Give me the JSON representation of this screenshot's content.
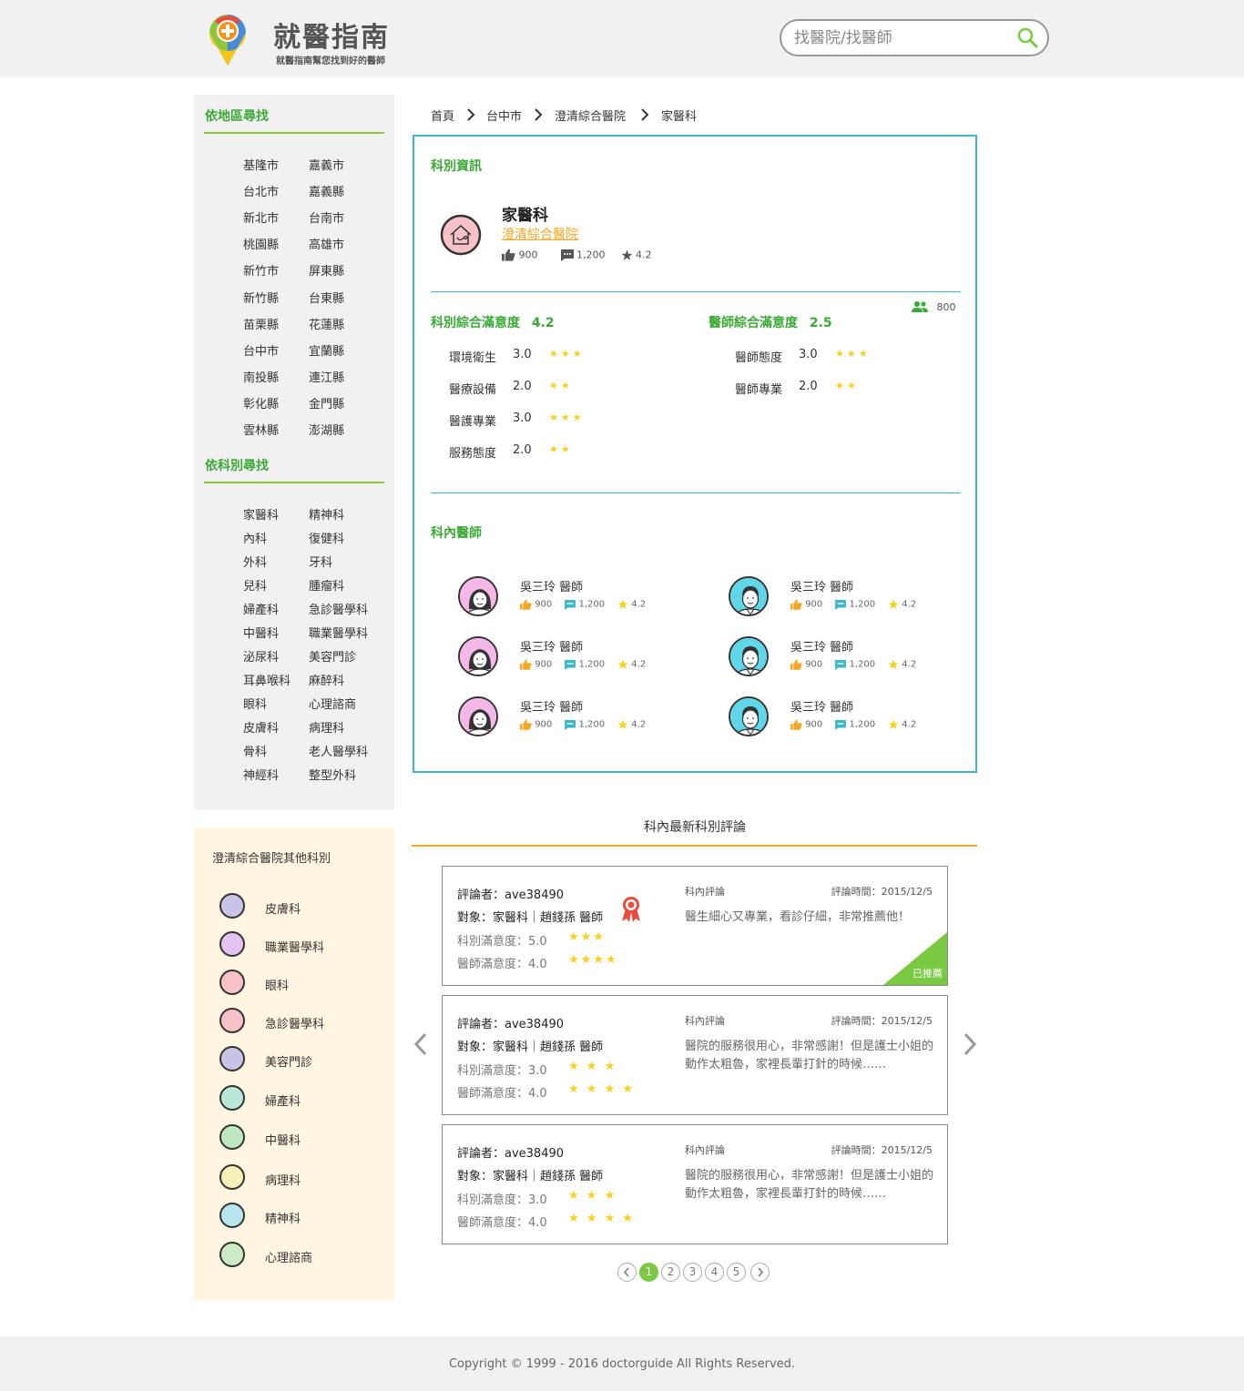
{
  "header": {
    "site_title": "就醫指南",
    "site_subtitle": "就醫指南幫您找到好的醫師",
    "search_placeholder": "找醫院/找醫師"
  },
  "sidebar": {
    "region_heading": "依地區尋找",
    "regions": [
      "基隆市",
      "嘉義市",
      "台北市",
      "嘉義縣",
      "新北市",
      "台南市",
      "桃園縣",
      "高雄市",
      "新竹市",
      "屏東縣",
      "新竹縣",
      "台東縣",
      "苗栗縣",
      "花蓮縣",
      "台中市",
      "宜蘭縣",
      "南投縣",
      "連江縣",
      "彰化縣",
      "金門縣",
      "雲林縣",
      "澎湖縣"
    ],
    "dept_heading": "依科別尋找",
    "departments": [
      "家醫科",
      "精神科",
      "內科",
      "復健科",
      "外科",
      "牙科",
      "兒科",
      "腫瘤科",
      "婦產科",
      "急診醫學科",
      "中醫科",
      "職業醫學科",
      "泌尿科",
      "美容門診",
      "耳鼻喉科",
      "麻醉科",
      "眼科",
      "心理諮商",
      "皮膚科",
      "病理科",
      "骨科",
      "老人醫學科",
      "神經科",
      "整型外科"
    ],
    "other_heading": "澄清綜合醫院其他科別",
    "other_depts": [
      {
        "label": "皮膚科",
        "icon": "skin-icon",
        "color": "#c9c3e6"
      },
      {
        "label": "職業醫學科",
        "icon": "hardhat-icon",
        "color": "#e3c4f0"
      },
      {
        "label": "眼科",
        "icon": "eye-icon",
        "color": "#f6c2c8"
      },
      {
        "label": "急診醫學科",
        "icon": "siren-icon",
        "color": "#f6c2c8"
      },
      {
        "label": "美容門診",
        "icon": "face-icon",
        "color": "#c9c3e6"
      },
      {
        "label": "婦產科",
        "icon": "uterus-icon",
        "color": "#b8e8d8"
      },
      {
        "label": "中醫科",
        "icon": "mortar-icon",
        "color": "#bfe8c0"
      },
      {
        "label": "病理科",
        "icon": "microscope-icon",
        "color": "#f7f0b8"
      },
      {
        "label": "精神科",
        "icon": "head-icon",
        "color": "#b8e6ef"
      },
      {
        "label": "心理諮商",
        "icon": "counsel-icon",
        "color": "#cdebc2"
      }
    ]
  },
  "breadcrumb": [
    "首頁",
    "台中市",
    "澄清綜合醫院",
    "家醫科"
  ],
  "info": {
    "section_title": "科別資訊",
    "dept_name": "家醫科",
    "hospital": "澄清綜合醫院",
    "likes": "900",
    "comments": "1,200",
    "rating": "4.2",
    "people_count": "800",
    "dept_sat_label": "科別綜合滿意度",
    "dept_sat_value": "4.2",
    "doc_sat_label": "醫師綜合滿意度",
    "doc_sat_value": "2.5",
    "dept_items": [
      {
        "label": "環境衛生",
        "value": "3.0",
        "stars": 3
      },
      {
        "label": "醫療設備",
        "value": "2.0",
        "stars": 2
      },
      {
        "label": "醫護專業",
        "value": "3.0",
        "stars": 3
      },
      {
        "label": "服務態度",
        "value": "2.0",
        "stars": 2
      }
    ],
    "doc_items": [
      {
        "label": "醫師態度",
        "value": "3.0",
        "stars": 3
      },
      {
        "label": "醫師專業",
        "value": "2.0",
        "stars": 2
      }
    ],
    "doctors_title": "科內醫師",
    "doctors": [
      {
        "name": "吳三玲 醫師",
        "likes": "900",
        "comments": "1,200",
        "rating": "4.2",
        "gender": "female"
      },
      {
        "name": "吳三玲 醫師",
        "likes": "900",
        "comments": "1,200",
        "rating": "4.2",
        "gender": "male"
      },
      {
        "name": "吳三玲 醫師",
        "likes": "900",
        "comments": "1,200",
        "rating": "4.2",
        "gender": "female"
      },
      {
        "name": "吳三玲 醫師",
        "likes": "900",
        "comments": "1,200",
        "rating": "4.2",
        "gender": "male"
      },
      {
        "name": "吳三玲 醫師",
        "likes": "900",
        "comments": "1,200",
        "rating": "4.2",
        "gender": "female"
      },
      {
        "name": "吳三玲 醫師",
        "likes": "900",
        "comments": "1,200",
        "rating": "4.2",
        "gender": "male"
      }
    ]
  },
  "reviews": {
    "title": "科內最新科別評論",
    "items": [
      {
        "reviewer": "評論者：ave38490",
        "target": "對象：家醫科｜趙錢孫 醫師",
        "dept_sat": "科別滿意度：5.0",
        "dept_stars": "★★★",
        "doc_sat": "醫師滿意度：4.0",
        "doc_stars": "★★★★",
        "tag": "科內評論",
        "time": "評論時間：2015/12/5",
        "text": "醫生細心又專業，看診仔細，非常推薦他！",
        "recommended": "已推薦"
      },
      {
        "reviewer": "評論者：ave38490",
        "target": "對象：家醫科｜趙錢孫 醫師",
        "dept_sat": "科別滿意度：3.0",
        "dept_stars": "★ ★ ★",
        "doc_sat": "醫師滿意度：4.0",
        "doc_stars": "★ ★ ★ ★",
        "tag": "科內評論",
        "time": "評論時間：2015/12/5",
        "text": "醫院的服務很用心，非常感謝！但是護士小姐的動作太粗魯，家裡長輩打針的時候……",
        "recommended": ""
      },
      {
        "reviewer": "評論者：ave38490",
        "target": "對象：家醫科｜趙錢孫 醫師",
        "dept_sat": "科別滿意度：3.0",
        "dept_stars": "★ ★ ★",
        "doc_sat": "醫師滿意度：4.0",
        "doc_stars": "★ ★ ★ ★",
        "tag": "科內評論",
        "time": "評論時間：2015/12/5",
        "text": "醫院的服務很用心，非常感謝！但是護士小姐的動作太粗魯，家裡長輩打針的時候……",
        "recommended": ""
      }
    ]
  },
  "pagination": {
    "pages": [
      "1",
      "2",
      "3",
      "4",
      "5"
    ],
    "current": "1"
  },
  "footer": {
    "copyright": "Copyright © 1999 - 2016 doctorguide All Rights Reserved."
  },
  "colors": {
    "green": "#3aa935",
    "teal": "#3db8c8",
    "orange": "#f5a623",
    "star": "#f7d11e"
  }
}
